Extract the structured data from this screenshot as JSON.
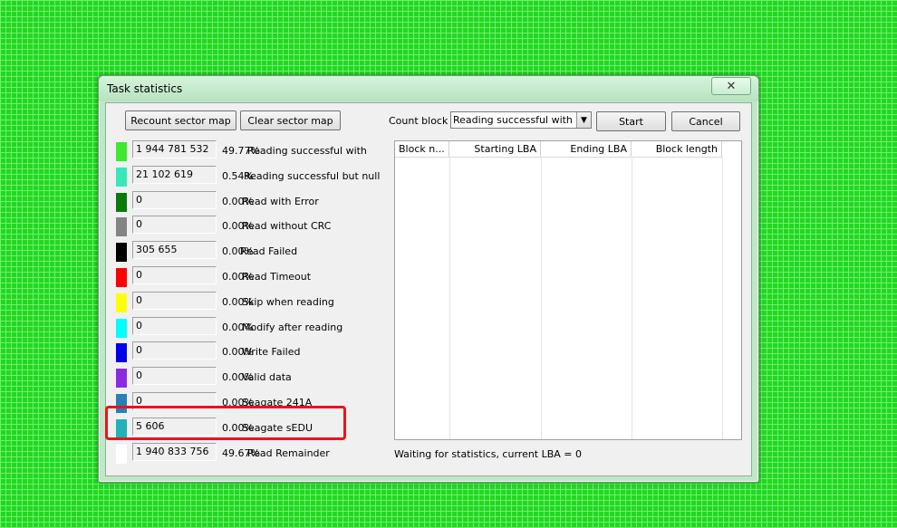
{
  "window": {
    "title": "Task statistics",
    "close_label": "✕"
  },
  "toolbar": {
    "recount_label": "Recount sector map",
    "clear_label": "Clear sector map",
    "count_block_label": "Count block",
    "count_block_value": "Reading successful with valid data",
    "start_label": "Start",
    "cancel_label": "Cancel"
  },
  "stats": [
    {
      "color": "#40e830",
      "count": "1 944 781 532",
      "pct": "49.77%",
      "name": "Reading successful with"
    },
    {
      "color": "#38e8b8",
      "count": "21 102 619",
      "pct": "0.54%",
      "name": "Reading successful but null"
    },
    {
      "color": "#0a7a0a",
      "count": "0",
      "pct": "0.00%",
      "name": "Read with Error"
    },
    {
      "color": "#848484",
      "count": "0",
      "pct": "0.00%",
      "name": "Read without CRC"
    },
    {
      "color": "#000000",
      "count": "305 655",
      "pct": "0.00%",
      "name": "Read Failed"
    },
    {
      "color": "#ff0000",
      "count": "0",
      "pct": "0.00%",
      "name": "Read Timeout"
    },
    {
      "color": "#ffff00",
      "count": "0",
      "pct": "0.00%",
      "name": "Skip when reading"
    },
    {
      "color": "#00ffff",
      "count": "0",
      "pct": "0.00%",
      "name": "Modify after reading"
    },
    {
      "color": "#0000e8",
      "count": "0",
      "pct": "0.00%",
      "name": "Write Failed"
    },
    {
      "color": "#8a2be2",
      "count": "0",
      "pct": "0.00%",
      "name": "Valid data"
    },
    {
      "color": "#2a7fb8",
      "count": "0",
      "pct": "0.00%",
      "name": "Seagate 241A"
    },
    {
      "color": "#20b2b8",
      "count": "5 606",
      "pct": "0.00%",
      "name": "Seagate sEDU"
    },
    {
      "color": "#ffffff",
      "count": "1 940 833 756",
      "pct": "49.67%",
      "name": "Read Remainder"
    }
  ],
  "table": {
    "columns": [
      "Block n...",
      "Starting LBA",
      "Ending LBA",
      "Block length"
    ]
  },
  "status": "Waiting for statistics, current LBA = 0"
}
